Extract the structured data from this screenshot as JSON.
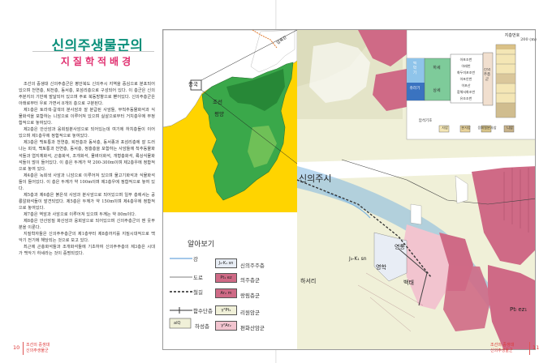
{
  "left_page": {
    "title": "신의주생물군의",
    "subtitle": "지질학적배경",
    "paragraphs": [
      "조선의 중생대 신의주층군은 평안북도 신의주시 지역을 중심으로 분포되어 있으며 천연층, 퇴전층, 동서층, 포섬리층으로 구성되어 있다. 이 층군은 신의주분지의 기반에 발달되어 있으며 주로 북동방향으로 뻗어있다. 신의주층군은 아래로부터 우로 가면서 8개의 층으로 구분된다.",
      "제1층은 토라색-갈색의 분사암과 잘 분급된 사암들, 무척추동물화석과 식물화석을 포함하는 니암으로 이루어져 있으며 실살으로부터 거치층우에 부정합적으로 놓여있다.",
      "제2층은 안산암과 응회질분사암으로 되어있는데 여기에 하치층들이 이어 있으며 제1층우에 정합적으로 놓여있다.",
      "제3층은 백토통과 천연층, 퇴전층과 동서층, 동서종과 포섬리층에 잘 드러나는 회색, 백토통과 천연층, 동서층, 정흥층을 포함하는 사암들에 척추동물화석들과 엽지체화석, 곤충화석, 조개화석, 물벼이화석, 개형충화석, 륙상식물화석들이 많이 들어있다. 이 층은 두께가 약 200-300m이며 제2층우에 정합적으로 놓여 있다.",
      "제4층은 녹회색 사암과 니암으로 이루어져 있으며 물고기화석과 식물화석들이 들어있다. 이 층은 두께가 약 100m이며 제3층우에 정합적으로 놓여 있다.",
      "제5층과 제6층은 붉은색 사암과 분사암으로 되어있으며 일부 층에서는 공룡알화석들이 발견되었다. 제5층은 두께가 약 150m이며 제4층우에 정합적으로 놓여있다.",
      "제7층은 역암과 사암으로 이루어져 있으며 두께는 약 80m이다.",
      "제8층은 안산암질 화산암과 응회암으로 되어있으며 신의주층군의 맨 웃부분을 이룬다.",
      "지질학자들은 신의주주층군의 제1층부터 제8층까지를 지질시대적으로 백악기 전기에 해당되는 것으로 보고 있다.",
      "최근에 곤충화석들과 조개화석들에 기초하여 신의주주층의 제3층은 시대가 백악기 하세라는 것이 증명되었다."
    ],
    "folio": "10",
    "running_head": [
      "조선의 중생대",
      "신의주생물군"
    ]
  },
  "right_page": {
    "folio": "11",
    "running_head": [
      "조선의 중생대",
      "신의주생물군"
    ],
    "inset_map": {
      "labels": {
        "china": "중국",
        "korea": "조선",
        "pyongyang": "평양",
        "yalu": "압록강"
      }
    },
    "stratigraphy": {
      "scale_label": "지층번호",
      "depth_label": "200 (m)",
      "era_col": [
        "백",
        "악",
        "기"
      ],
      "sub_upper": "하세",
      "sub_lower": "쥬라기",
      "upper_label": "상세",
      "group_label": "신의주층군",
      "units": [
        "아포조번",
        "아래번",
        "화두미포조번",
        "아포안번",
        "이포산",
        "합해서화조번",
        "유조조번"
      ],
      "bottom_label": "암석기호",
      "legend_items": [
        "사암",
        "분사암",
        "응회질분사암",
        "니암"
      ]
    },
    "detail_map": {
      "city_label": "신의주시",
      "labels": [
        "영통",
        "영학",
        "백태",
        "하서리",
        "Ptₗ ez₁",
        "J₃-K₁ sn"
      ]
    },
    "legend": {
      "title": "알아보기",
      "lines": [
        {
          "label": "강"
        },
        {
          "label": "도로"
        },
        {
          "label": "철길"
        },
        {
          "label": "함수단층"
        },
        {
          "label": "하성층",
          "code": "aIQ"
        }
      ],
      "units": [
        {
          "code": "J₃-K₁ sn",
          "label": "신의주주층",
          "color": "#e8edf5"
        },
        {
          "code": "Pt₁ ez",
          "label": "의주층군",
          "color": "#cf6a86"
        },
        {
          "code": "Ar₂ m",
          "label": "랑림층군",
          "color": "#cf6a86"
        },
        {
          "code": "γ²Pt₁",
          "label": "리원암군",
          "color": "#f0f0d8"
        },
        {
          "code": "γ²Ar₂",
          "label": "편화산암군",
          "color": "#f2c4cf"
        }
      ]
    }
  },
  "colors": {
    "title": "#0a8f7a",
    "subtitle": "#e03070",
    "sea": "#ffd400",
    "land_green": "#3aa84a",
    "land_dark": "#1f7a2f",
    "geology_pink": "#cf6a86",
    "geology_light_pink": "#f2c4cf",
    "geology_cream": "#f0f0d8",
    "water_blue": "#7fb6e0"
  }
}
